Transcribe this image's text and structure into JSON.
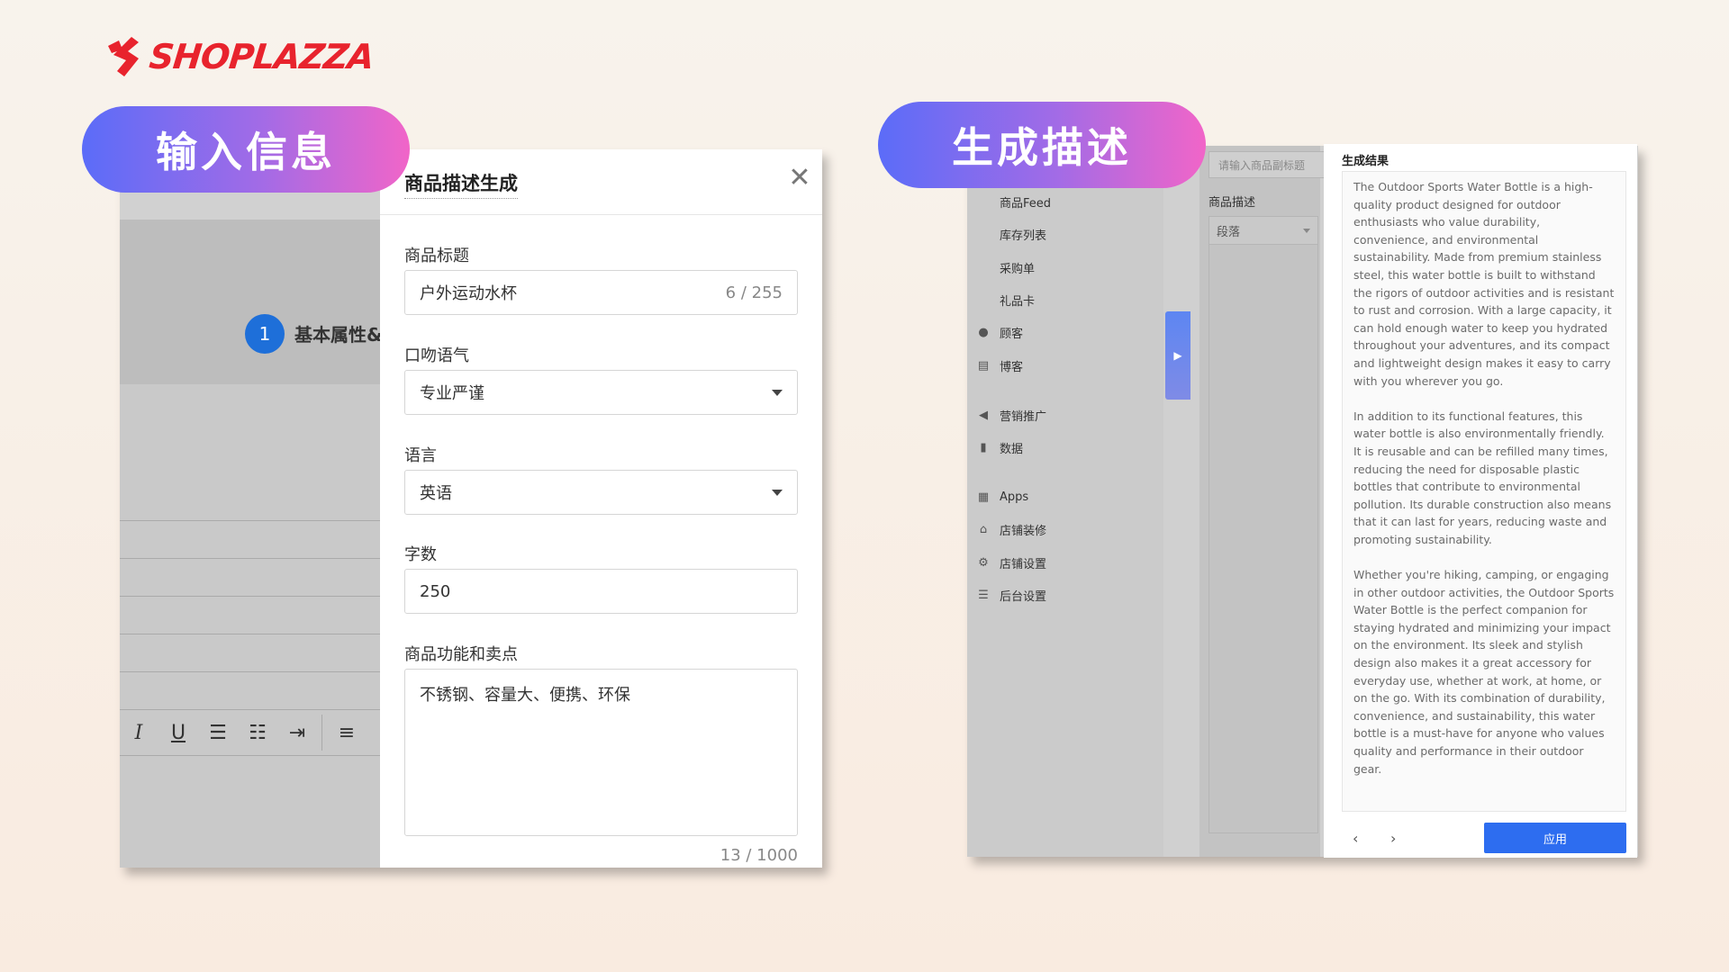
{
  "brand": {
    "name": "SHOPLAZZA",
    "color": "#e8232d"
  },
  "pills": {
    "left": "输入信息",
    "right": "生成描述"
  },
  "left_editor": {
    "step_number": "1",
    "step_label": "基本属性&",
    "toolbar_icons": [
      "italic-icon",
      "underline-icon",
      "bullet-list-icon",
      "numbered-list-icon",
      "indent-icon",
      "align-icon"
    ]
  },
  "modal": {
    "title": "商品描述生成",
    "fields": {
      "title_label": "商品标题",
      "title_value": "户外运动水杯",
      "title_counter": "6 / 255",
      "tone_label": "口吻语气",
      "tone_value": "专业严谨",
      "language_label": "语言",
      "language_value": "英语",
      "wordcount_label": "字数",
      "wordcount_value": "250",
      "features_label": "商品功能和卖点",
      "features_value": "不锈钢、容量大、便携、环保",
      "features_counter": "13 / 1000"
    }
  },
  "right_sidebar": {
    "items": [
      {
        "label": "商品Feed",
        "icon": ""
      },
      {
        "label": "库存列表",
        "icon": ""
      },
      {
        "label": "采购单",
        "icon": ""
      },
      {
        "label": "礼品卡",
        "icon": ""
      },
      {
        "label": "顾客",
        "icon": "user-icon"
      },
      {
        "label": "博客",
        "icon": "blog-icon"
      },
      {
        "label": "营销推广",
        "icon": "megaphone-icon"
      },
      {
        "label": "数据",
        "icon": "bar-chart-icon"
      },
      {
        "label": "Apps",
        "icon": "apps-icon"
      },
      {
        "label": "店铺装修",
        "icon": "store-icon"
      },
      {
        "label": "店铺设置",
        "icon": "gear-icon"
      },
      {
        "label": "后台设置",
        "icon": "server-icon"
      }
    ]
  },
  "right_mid": {
    "subtitle_placeholder": "请输入商品副标题",
    "desc_label": "商品描述",
    "paragraph_select": "段落"
  },
  "result": {
    "title": "生成结果",
    "text": "The Outdoor Sports Water Bottle is a high-quality product designed for outdoor enthusiasts who value durability, convenience, and environmental sustainability. Made from premium stainless steel, this water bottle is built to withstand the rigors of outdoor activities and is resistant to rust and corrosion. With a large capacity, it can hold enough water to keep you hydrated throughout your adventures, and its compact and lightweight design makes it easy to carry with you wherever you go.\n\nIn addition to its functional features, this water bottle is also environmentally friendly. It is reusable and can be refilled many times, reducing the need for disposable plastic bottles that contribute to environmental pollution. Its durable construction also means that it can last for years, reducing waste and promoting sustainability.\n\nWhether you're hiking, camping, or engaging in other outdoor activities, the Outdoor Sports Water Bottle is the perfect companion for staying hydrated and minimizing your impact on the environment. Its sleek and stylish design also makes it a great accessory for everyday use, whether at work, at home, or on the go. With its combination of durability, convenience, and sustainability, this water bottle is a must-have for anyone who values quality and performance in their outdoor gear.",
    "prev": "‹",
    "next": "›",
    "apply_label": "应用"
  }
}
